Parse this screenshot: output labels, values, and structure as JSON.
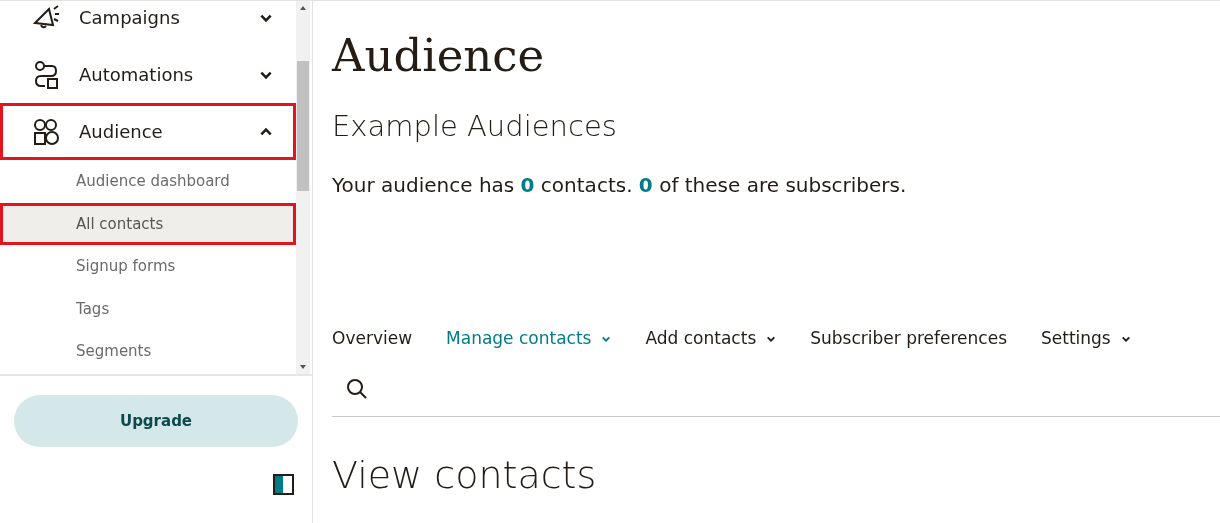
{
  "sidebar": {
    "items": [
      {
        "label": "Campaigns",
        "expanded": false,
        "highlighted": false
      },
      {
        "label": "Automations",
        "expanded": false,
        "highlighted": false
      },
      {
        "label": "Audience",
        "expanded": true,
        "highlighted": true,
        "children": [
          {
            "label": "Audience dashboard",
            "selected": false,
            "highlighted": false
          },
          {
            "label": "All contacts",
            "selected": true,
            "highlighted": true
          },
          {
            "label": "Signup forms",
            "selected": false,
            "highlighted": false
          },
          {
            "label": "Tags",
            "selected": false,
            "highlighted": false
          },
          {
            "label": "Segments",
            "selected": false,
            "highlighted": false
          }
        ]
      }
    ],
    "upgrade_button": "Upgrade"
  },
  "page": {
    "title": "Audience",
    "subtitle": "Example Audiences",
    "summary": "Your audience has **0** contacts. **0** of these are subscribers.",
    "tabs": [
      {
        "label": "Overview",
        "selected": false,
        "menu": false
      },
      {
        "label": "Manage contacts",
        "selected": true,
        "menu": true
      },
      {
        "label": "Add contacts",
        "selected": false,
        "menu": true
      },
      {
        "label": "Subscriber preferences",
        "selected": false,
        "menu": false
      },
      {
        "label": "Settings",
        "selected": false,
        "menu": true
      }
    ],
    "section_title": "View contacts"
  }
}
